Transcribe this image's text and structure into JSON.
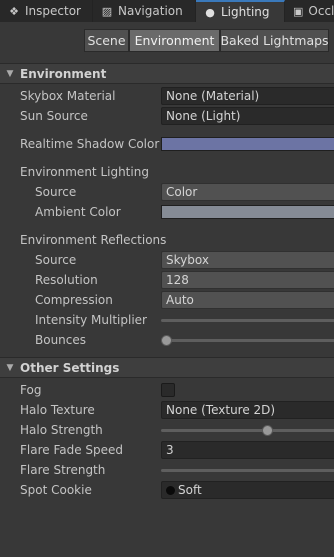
{
  "tabs": [
    {
      "label": "Inspector",
      "icon": "info-icon"
    },
    {
      "label": "Navigation",
      "icon": "navigation-icon"
    },
    {
      "label": "Lighting",
      "icon": "lightbulb-icon"
    },
    {
      "label": "Occl",
      "icon": "occlusion-icon"
    }
  ],
  "toolbar": {
    "scene": "Scene",
    "environment": "Environment",
    "baked": "Baked Lightmaps"
  },
  "environment": {
    "header": "Environment",
    "skybox_label": "Skybox Material",
    "skybox_value": "None (Material)",
    "sun_label": "Sun Source",
    "sun_value": "None (Light)",
    "shadow_label": "Realtime Shadow Color",
    "shadow_color": "#6c74a4",
    "lighting_header": "Environment Lighting",
    "source_label": "Source",
    "source_value": "Color",
    "ambient_label": "Ambient Color",
    "ambient_color": "#858b95",
    "reflections_header": "Environment Reflections",
    "refl_source_label": "Source",
    "refl_source_value": "Skybox",
    "resolution_label": "Resolution",
    "resolution_value": "128",
    "compression_label": "Compression",
    "compression_value": "Auto",
    "intensity_label": "Intensity Multiplier",
    "bounces_label": "Bounces"
  },
  "other": {
    "header": "Other Settings",
    "fog_label": "Fog",
    "halo_texture_label": "Halo Texture",
    "halo_texture_value": "None (Texture 2D)",
    "halo_strength_label": "Halo Strength",
    "flare_fade_label": "Flare Fade Speed",
    "flare_fade_value": "3",
    "flare_strength_label": "Flare Strength",
    "spot_cookie_label": "Spot Cookie",
    "spot_cookie_value": "Soft"
  },
  "colors": {
    "accent": "#3a79bb",
    "background": "#383838"
  }
}
